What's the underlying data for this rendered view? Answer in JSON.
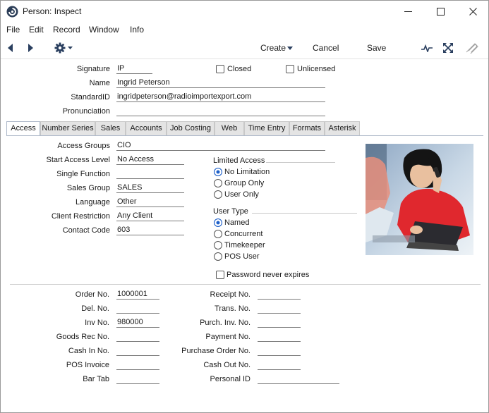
{
  "window": {
    "title": "Person: Inspect",
    "minimize": "—",
    "maximize": "☐",
    "close": "✕"
  },
  "menu": [
    "File",
    "Edit",
    "Record",
    "Window",
    "Info"
  ],
  "toolbar": {
    "create_label": "Create",
    "cancel_label": "Cancel",
    "save_label": "Save"
  },
  "header": {
    "signature_label": "Signature",
    "signature": "IP",
    "closed_label": "Closed",
    "closed": false,
    "unlicensed_label": "Unlicensed",
    "unlicensed": false,
    "name_label": "Name",
    "name": "Ingrid Peterson",
    "standardid_label": "StandardID",
    "standardid": "ingridpeterson@radioimportexport.com",
    "pronunciation_label": "Pronunciation",
    "pronunciation": ""
  },
  "tabs": [
    "Access",
    "Number Series",
    "Sales",
    "Accounts",
    "Job Costing",
    "Web",
    "Time Entry",
    "Formats",
    "Asterisk"
  ],
  "active_tab": "Access",
  "access": {
    "access_groups_label": "Access Groups",
    "access_groups": "CIO",
    "start_access_level_label": "Start Access Level",
    "start_access_level": "No Access",
    "single_function_label": "Single Function",
    "single_function": "",
    "sales_group_label": "Sales Group",
    "sales_group": "SALES",
    "language_label": "Language",
    "language": "Other",
    "client_restriction_label": "Client Restriction",
    "client_restriction": "Any Client",
    "contact_code_label": "Contact Code",
    "contact_code": "603",
    "limited_access_title": "Limited Access",
    "limited_access_options": [
      "No Limitation",
      "Group Only",
      "User Only"
    ],
    "limited_access_selected": "No Limitation",
    "user_type_title": "User Type",
    "user_type_options": [
      "Named",
      "Concurrent",
      "Timekeeper",
      "POS User"
    ],
    "user_type_selected": "Named",
    "password_never_expires_label": "Password never expires",
    "password_never_expires": false
  },
  "numbers": {
    "order_no_label": "Order No.",
    "order_no": "1000001",
    "del_no_label": "Del. No.",
    "del_no": "",
    "inv_no_label": "Inv No.",
    "inv_no": "980000",
    "goods_rec_no_label": "Goods Rec No.",
    "goods_rec_no": "",
    "cash_in_no_label": "Cash In No.",
    "cash_in_no": "",
    "pos_invoice_label": "POS Invoice",
    "pos_invoice": "",
    "bar_tab_label": "Bar Tab",
    "bar_tab": "",
    "receipt_no_label": "Receipt No.",
    "receipt_no": "",
    "trans_no_label": "Trans. No.",
    "trans_no": "",
    "purch_inv_no_label": "Purch. Inv. No.",
    "purch_inv_no": "",
    "payment_no_label": "Payment No.",
    "payment_no": "",
    "purchase_order_no_label": "Purchase Order No.",
    "purchase_order_no": "",
    "cash_out_no_label": "Cash Out No.",
    "cash_out_no": "",
    "personal_id_label": "Personal ID",
    "personal_id": ""
  },
  "colors": {
    "accent": "#1d5fc9",
    "tab_inactive": "#e4e4e4",
    "photo_shirt": "#e0282e"
  },
  "icons": {
    "app": "app-logo-icon",
    "back": "triangle-left-icon",
    "forward": "triangle-right-icon",
    "settings": "gear-icon",
    "activity": "pulse-icon",
    "expand": "expand-arrows-icon",
    "attach": "paperclip-icon"
  }
}
